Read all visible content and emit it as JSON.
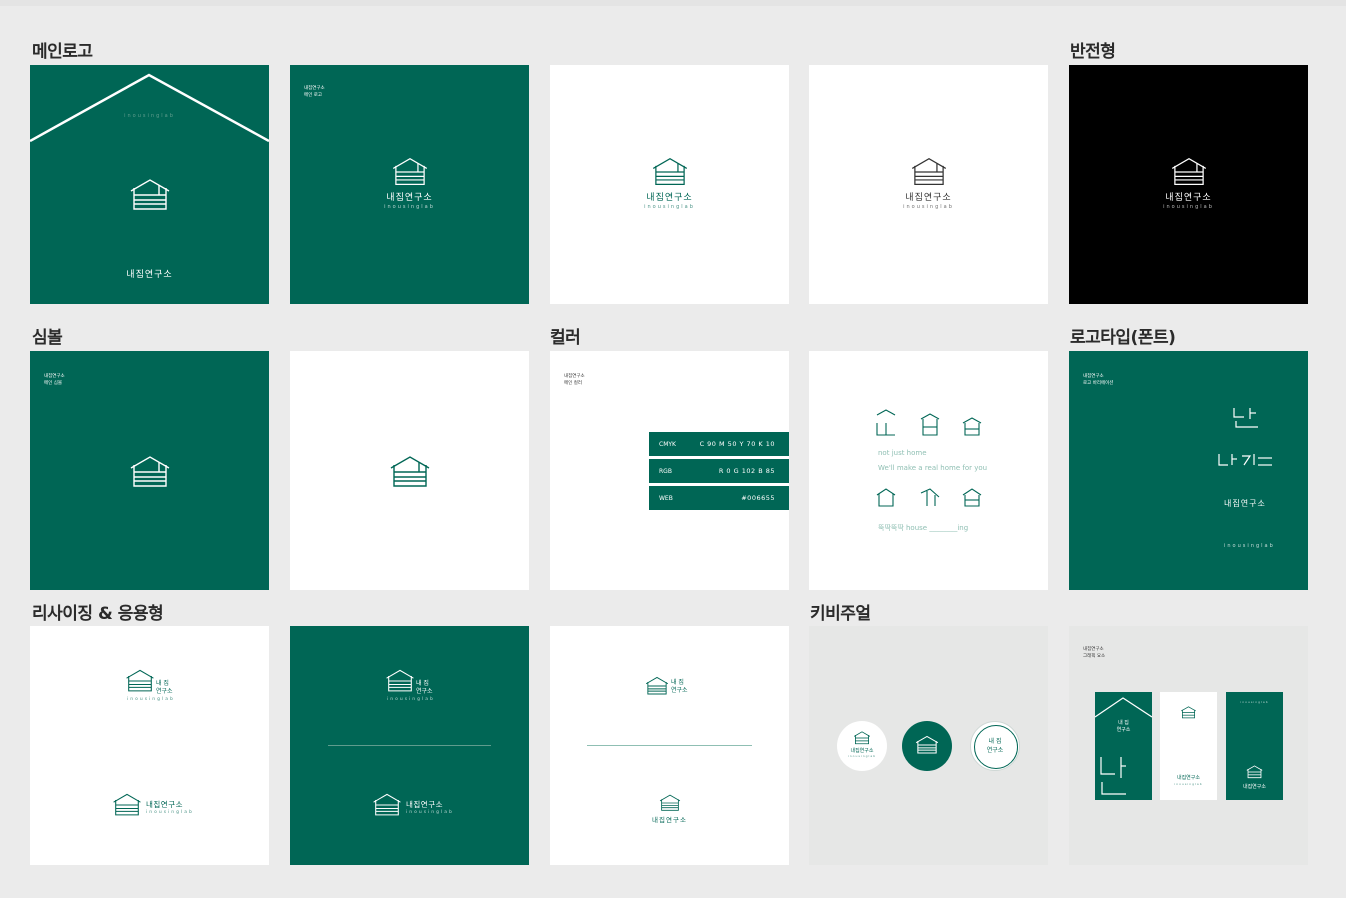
{
  "sections": {
    "main_logo": "메인로고",
    "inverted": "반전형",
    "symbol": "심볼",
    "color": "컬러",
    "logotype": "로고타입(폰트)",
    "resize": "리사이징 & 응용형",
    "keyvisual": "키비주얼"
  },
  "brand": {
    "name_ko": "내집연구소",
    "name_en": "inousinglab",
    "name_ko_stacked_1": "내 집",
    "name_ko_stacked_2": "연구소"
  },
  "captions": {
    "main_logo": "내집연구소\n메인 로고",
    "symbol": "내집연구소\n메인 심볼",
    "color": "내집연구소\n메인 컬러",
    "logotype": "내집연구소\n로고 바리에이션",
    "graphic": "내집연구소\n그래픽 요소"
  },
  "color_specs": [
    {
      "key": "CMYK",
      "value": "C 90   M 50   Y 70   K 10"
    },
    {
      "key": "RGB",
      "value": "R 0   G 102   B 85"
    },
    {
      "key": "WEB",
      "value": "#006655"
    }
  ],
  "slogans": {
    "line1": "not just home",
    "line2": "We'll make a real home for you",
    "line3": "뚝딱뚝딱 house ________ing"
  },
  "colors": {
    "brand_green": "#006655",
    "white": "#ffffff",
    "black": "#000000",
    "light_grey": "#e6e7e6"
  },
  "icons": [
    "house-logo-icon"
  ]
}
